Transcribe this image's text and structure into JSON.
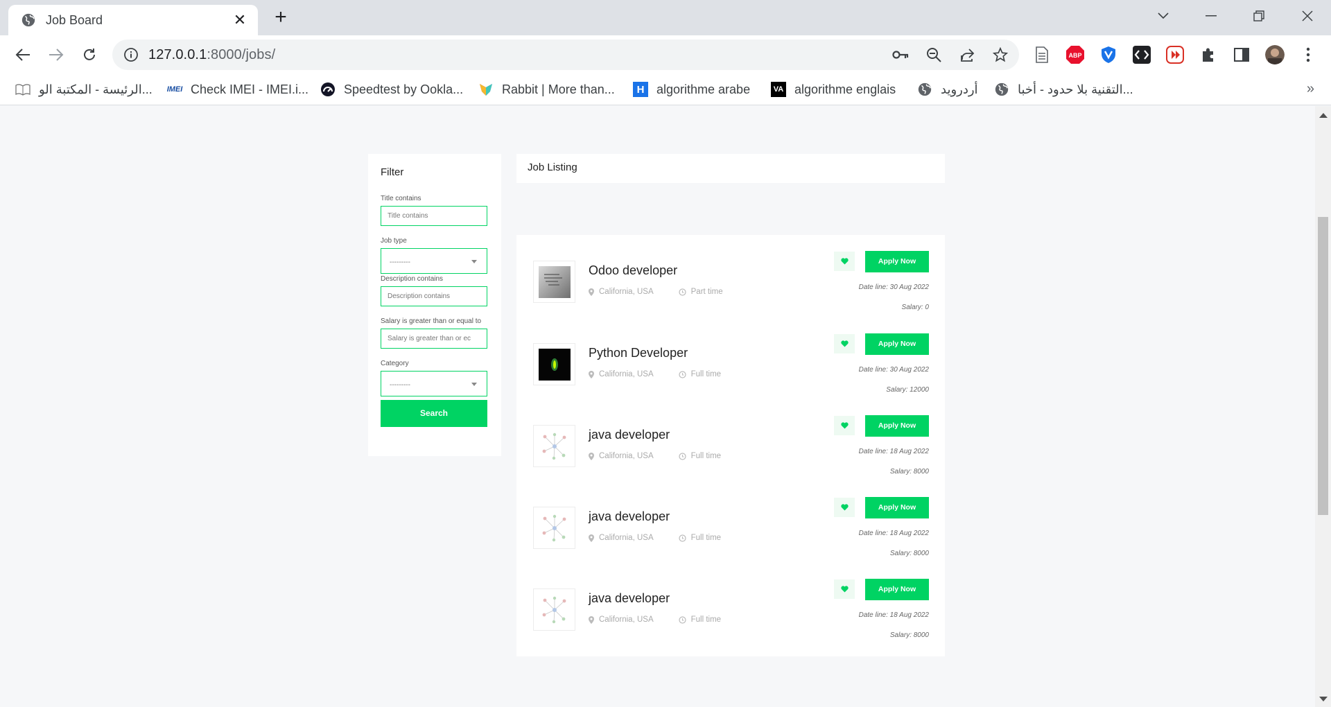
{
  "browser": {
    "tab_title": "Job Board",
    "url_host": "127.0.0.1",
    "url_path": ":8000/jobs/",
    "extensions": [
      "document-icon",
      "adblock-icon",
      "vpn-shield-icon",
      "code-icon",
      "media-icon",
      "puzzle-icon",
      "sidepanel-icon",
      "profile-avatar"
    ],
    "abp_label": "ABP",
    "bookmarks": [
      {
        "label": "الرئيسة - المكتبة الو...",
        "icon": "book-icon"
      },
      {
        "label": "Check IMEI - IMEI.i...",
        "icon": "imei-icon",
        "badge": "IMEI"
      },
      {
        "label": "Speedtest by Ookla...",
        "icon": "speedtest-icon"
      },
      {
        "label": "Rabbit | More than...",
        "icon": "rabbit-icon"
      },
      {
        "label": "algorithme arabe",
        "icon": "h-icon",
        "badge": "H"
      },
      {
        "label": "algorithme englais",
        "icon": "va-icon",
        "badge": "VA"
      },
      {
        "label": "أردرويد",
        "icon": "globe-icon"
      },
      {
        "label": "التقنية بلا حدود - أخبا...",
        "icon": "globe-icon"
      }
    ],
    "bookmarks_more": "»"
  },
  "filter": {
    "title": "Filter",
    "title_label": "Title contains",
    "title_placeholder": "Title contains",
    "jobtype_label": "Job type",
    "jobtype_value": "---------",
    "desc_label": "Description contains",
    "desc_placeholder": "Description contains",
    "salary_label": "Salary is greater than or equal to",
    "salary_placeholder": "Salary is greater than or ec",
    "category_label": "Category",
    "category_value": "---------",
    "search_label": "Search"
  },
  "listing": {
    "heading": "Job Listing",
    "apply_label": "Apply Now",
    "jobs": [
      {
        "title": "Odoo developer",
        "location": "California, USA",
        "type": "Part time",
        "date": "Date line: 30 Aug 2022",
        "salary": "Salary: 0",
        "thumb": "odoo"
      },
      {
        "title": "Python Developer",
        "location": "California, USA",
        "type": "Full time",
        "date": "Date line: 30 Aug 2022",
        "salary": "Salary: 12000",
        "thumb": "python"
      },
      {
        "title": "java developer",
        "location": "California, USA",
        "type": "Full time",
        "date": "Date line: 18 Aug 2022",
        "salary": "Salary: 8000",
        "thumb": "java"
      },
      {
        "title": "java developer",
        "location": "California, USA",
        "type": "Full time",
        "date": "Date line: 18 Aug 2022",
        "salary": "Salary: 8000",
        "thumb": "java"
      },
      {
        "title": "java developer",
        "location": "California, USA",
        "type": "Full time",
        "date": "Date line: 18 Aug 2022",
        "salary": "Salary: 8000",
        "thumb": "java"
      }
    ]
  },
  "colors": {
    "accent": "#00d363",
    "page_bg": "#f6f7f9"
  }
}
